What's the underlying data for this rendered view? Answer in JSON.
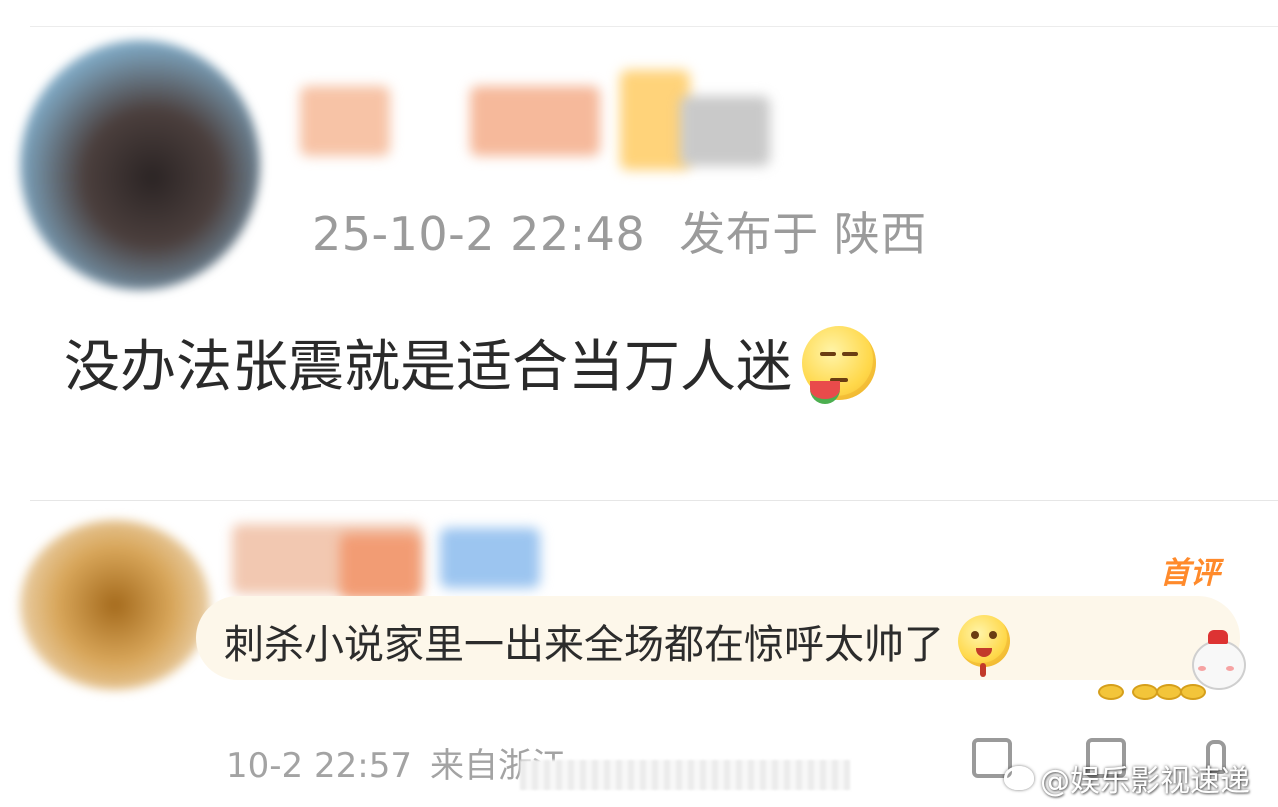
{
  "post": {
    "timestamp": "25-10-2 22:48",
    "location": "发布于 陕西",
    "text": "没办法张震就是适合当万人迷",
    "emoji": "smug-watermelon-emoji"
  },
  "reply": {
    "badge": "首评",
    "text": "刺杀小说家里一出来全场都在惊呼太帅了",
    "emoji": "drooling-emoji",
    "timestamp": "10-2 22:57",
    "location_partial": "来自浙江"
  },
  "actions": [
    "comment-icon",
    "share-icon",
    "like-icon"
  ],
  "watermark": "@娱乐影视速递",
  "colors": {
    "meta_gray": "#9b9b9b",
    "badge_orange": "#ff8a2b",
    "bubble_bg": "#fdf7ea"
  }
}
